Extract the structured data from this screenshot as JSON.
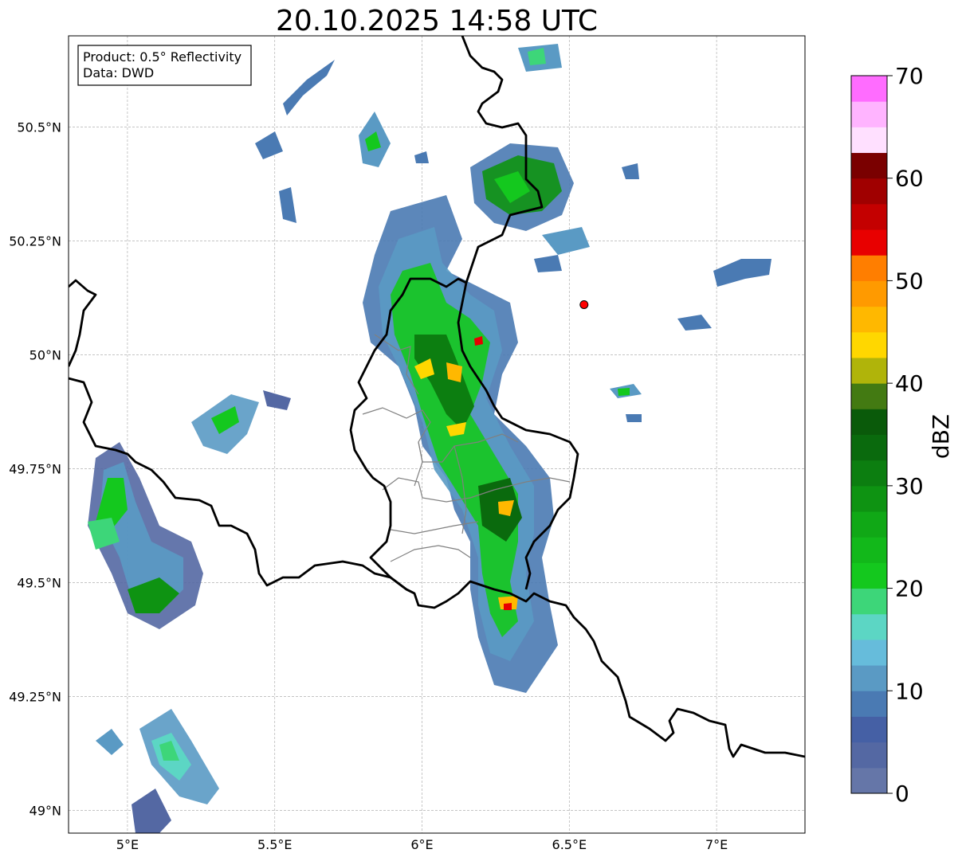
{
  "title": "20.10.2025 14:58 UTC",
  "info_box": {
    "line1": "Product: 0.5° Reflectivity",
    "line2": "Data: DWD"
  },
  "map": {
    "lon_ticks": [
      {
        "value": 5.0,
        "label": "5°E"
      },
      {
        "value": 5.5,
        "label": "5.5°E"
      },
      {
        "value": 6.0,
        "label": "6°E"
      },
      {
        "value": 6.5,
        "label": "6.5°E"
      },
      {
        "value": 7.0,
        "label": "7°E"
      }
    ],
    "lat_ticks": [
      {
        "value": 49.0,
        "label": "49°N"
      },
      {
        "value": 49.25,
        "label": "49.25°N"
      },
      {
        "value": 49.5,
        "label": "49.5°N"
      },
      {
        "value": 49.75,
        "label": "49.75°N"
      },
      {
        "value": 50.0,
        "label": "50°N"
      },
      {
        "value": 50.25,
        "label": "50.25°N"
      },
      {
        "value": 50.5,
        "label": "50.5°N"
      }
    ],
    "extent": {
      "lon_min": 4.8,
      "lon_max": 7.3,
      "lat_min": 48.95,
      "lat_max": 50.7
    },
    "radar_site": {
      "lon": 6.55,
      "lat": 50.11,
      "color": "#ff0000"
    },
    "gridlines": true,
    "border_color": "#000000",
    "district_color": "#808080"
  },
  "colorbar": {
    "label": "dBZ",
    "min": 0,
    "max": 70,
    "step": 2.5,
    "tick_values": [
      0,
      10,
      20,
      30,
      40,
      50,
      60,
      70
    ],
    "tick_labels": [
      "0",
      "10",
      "20",
      "30",
      "40",
      "50",
      "60",
      "70"
    ],
    "colors": [
      "#6576a8",
      "#5468a3",
      "#4560a5",
      "#4a7ab3",
      "#5a9ac4",
      "#66bcdb",
      "#5cd6c4",
      "#3dd679",
      "#14c81e",
      "#12b81a",
      "#10a816",
      "#0e9312",
      "#0c7e10",
      "#0a6a0d",
      "#0a5a0a",
      "#437a12",
      "#b0b40a",
      "#ffd700",
      "#ffb800",
      "#ff9a00",
      "#ff7e00",
      "#e80000",
      "#c40000",
      "#a00000",
      "#7a0000",
      "#ffe0ff",
      "#ffb4ff",
      "#ff6cff",
      "#ea36ea"
    ]
  }
}
